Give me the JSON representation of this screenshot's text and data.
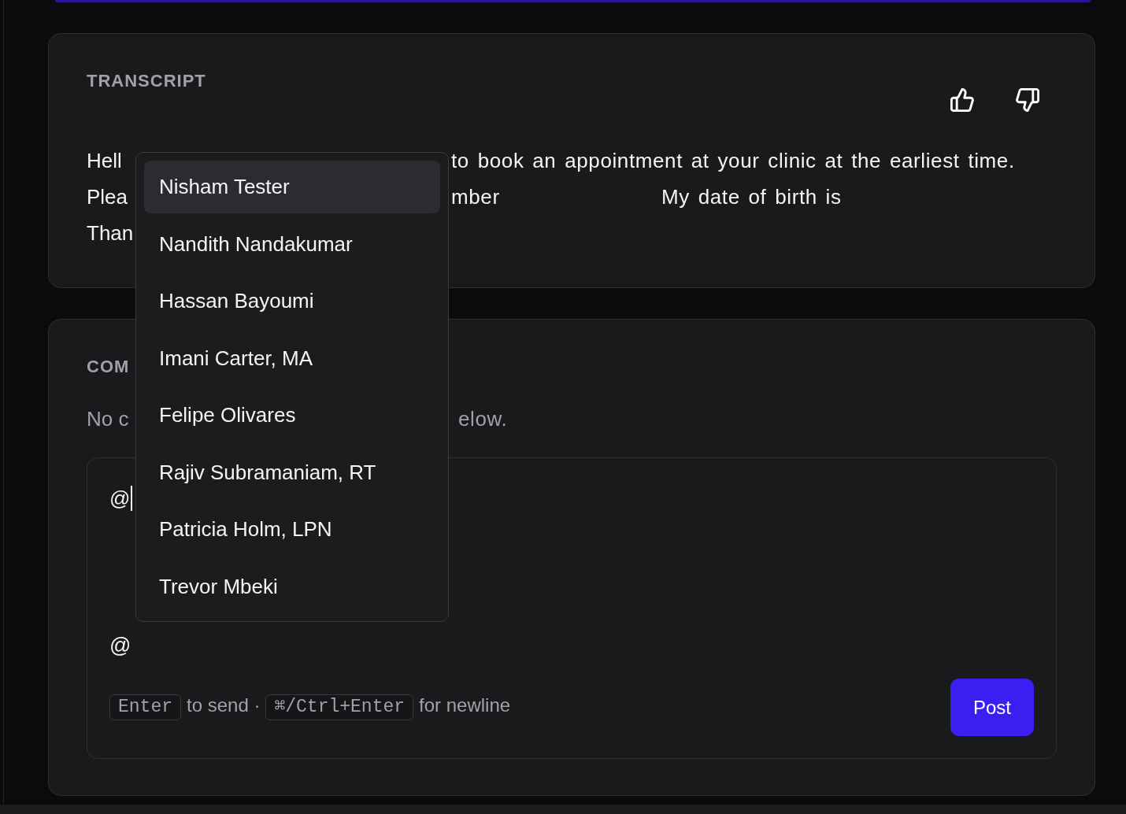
{
  "transcript": {
    "label": "TRANSCRIPT",
    "lines": [
      [
        "Hell",
        "to book an appointment at your clinic at the earliest time."
      ],
      [
        "Plea",
        "mber",
        "My date of birth is"
      ],
      [
        "Than"
      ]
    ]
  },
  "comments": {
    "label": "COM",
    "empty_message": [
      "No c",
      "elow."
    ],
    "comment_box": {
      "value": "@",
      "focused": true
    },
    "mention_button": "@",
    "hints": [
      {
        "kind": "key",
        "text": "Enter"
      },
      {
        "kind": "text",
        "text": "to send ·"
      },
      {
        "kind": "key",
        "text": "⌘/Ctrl+Enter"
      },
      {
        "kind": "text",
        "text": "for newline"
      }
    ],
    "post_button": "Post"
  },
  "mention_menu": {
    "items": [
      {
        "label": "Nisham Tester",
        "selected": true
      },
      {
        "label": "Nandith Nandakumar",
        "selected": false
      },
      {
        "label": "Hassan Bayoumi",
        "selected": false
      },
      {
        "label": "Imani Carter, MA",
        "selected": false
      },
      {
        "label": "Felipe Olivares",
        "selected": false
      },
      {
        "label": "Rajiv Subramaniam, RT",
        "selected": false
      },
      {
        "label": "Patricia Holm, LPN",
        "selected": false
      },
      {
        "label": "Trevor Mbeki",
        "selected": false
      }
    ]
  }
}
